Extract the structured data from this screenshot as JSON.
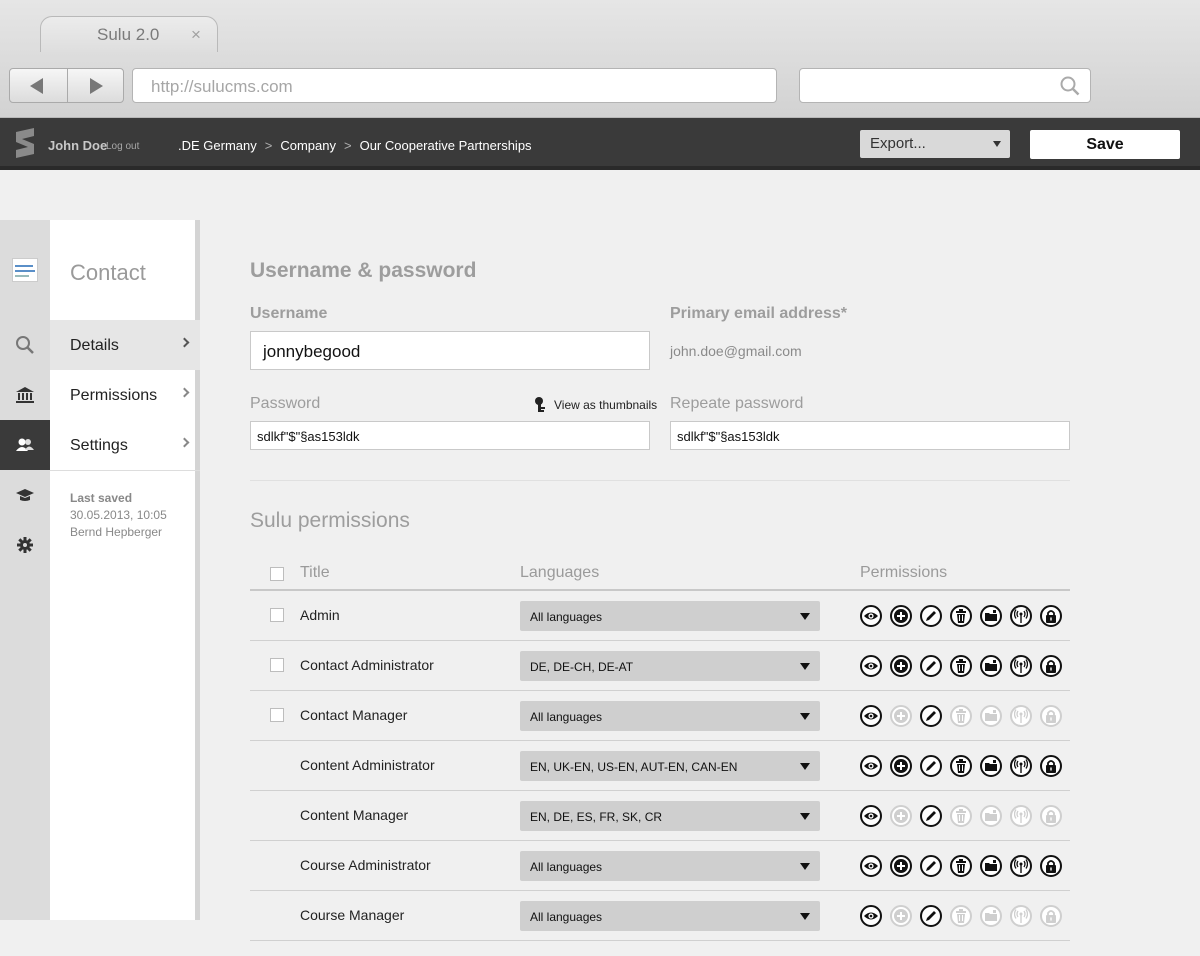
{
  "browser": {
    "tab_title": "Sulu 2.0",
    "tab_close": "×",
    "url": "http://sulucms.com"
  },
  "topbar": {
    "user_name": "John Doe",
    "logout_label": "Log out",
    "breadcrumbs": [
      ".DE Germany",
      "Company",
      "Our Cooperative Partnerships"
    ],
    "export_label": "Export...",
    "save_label": "Save"
  },
  "subnav": {
    "title": "Contact",
    "items": [
      {
        "label": "Details",
        "active": true
      },
      {
        "label": "Permissions",
        "active": false
      },
      {
        "label": "Settings",
        "active": false
      }
    ],
    "last_saved_label": "Last saved",
    "last_saved_date": "30.05.2013, 10:05",
    "last_saved_by": "Bernd Hepberger"
  },
  "account": {
    "section_title": "Username & password",
    "username_label": "Username",
    "username_value": "jonnybegood",
    "email_label": "Primary email address*",
    "email_value": "john.doe@gmail.com",
    "password_label": "Password",
    "password_value": "sdlkf\"$\"§as153ldk",
    "view_thumbnails_label": "View as thumbnails",
    "repeat_password_label": "Repeate password",
    "repeat_password_value": "sdlkf\"$\"§as153ldk"
  },
  "permissions": {
    "section_title": "Sulu permissions",
    "headers": {
      "title": "Title",
      "languages": "Languages",
      "permissions": "Permissions"
    },
    "icon_names": [
      "view-icon",
      "add-icon",
      "edit-icon",
      "delete-icon",
      "archive-icon",
      "live-icon",
      "security-icon"
    ],
    "rows": [
      {
        "title": "Admin",
        "languages": "All languages",
        "checkbox": true,
        "enabled": [
          1,
          1,
          1,
          1,
          1,
          1,
          1
        ]
      },
      {
        "title": "Contact Administrator",
        "languages": "DE, DE-CH, DE-AT",
        "checkbox": true,
        "enabled": [
          1,
          1,
          1,
          1,
          1,
          1,
          1
        ]
      },
      {
        "title": "Contact Manager",
        "languages": "All languages",
        "checkbox": true,
        "enabled": [
          1,
          0,
          1,
          0,
          0,
          0,
          0
        ]
      },
      {
        "title": "Content Administrator",
        "languages": "EN, UK-EN, US-EN, AUT-EN, CAN-EN",
        "checkbox": false,
        "enabled": [
          1,
          1,
          1,
          1,
          1,
          1,
          1
        ]
      },
      {
        "title": "Content Manager",
        "languages": "EN, DE, ES, FR, SK, CR",
        "checkbox": false,
        "enabled": [
          1,
          0,
          1,
          0,
          0,
          0,
          0
        ]
      },
      {
        "title": "Course Administrator",
        "languages": "All languages",
        "checkbox": false,
        "enabled": [
          1,
          1,
          1,
          1,
          1,
          1,
          1
        ]
      },
      {
        "title": "Course Manager",
        "languages": "All languages",
        "checkbox": false,
        "enabled": [
          1,
          0,
          1,
          0,
          0,
          0,
          0
        ]
      }
    ]
  }
}
